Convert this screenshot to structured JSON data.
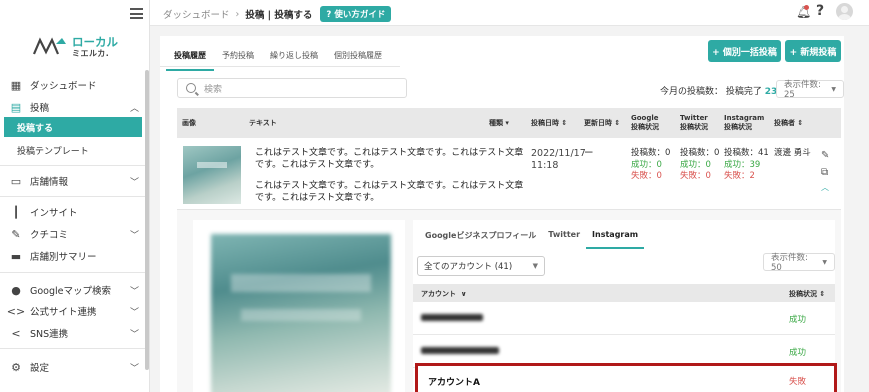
{
  "topbar": {
    "breadcrumb_root": "ダッシュボード",
    "breadcrumb_sep": "›",
    "breadcrumb_current": "投稿 | 投稿する",
    "guide_button": "使い方ガイド"
  },
  "sidebar": {
    "logo_main": "ローカル",
    "logo_sub": "ミエルカ.",
    "items": [
      {
        "label": "ダッシュボード"
      },
      {
        "label": "投稿"
      },
      {
        "label": "投稿する"
      },
      {
        "label": "投稿テンプレート"
      },
      {
        "label": "店舗情報"
      },
      {
        "label": "インサイト"
      },
      {
        "label": "クチコミ"
      },
      {
        "label": "店舗別サマリー"
      },
      {
        "label": "Googleマップ検索"
      },
      {
        "label": "公式サイト連携"
      },
      {
        "label": "SNS連携"
      },
      {
        "label": "設定"
      }
    ]
  },
  "main": {
    "tabs": [
      "投稿履歴",
      "予約投稿",
      "繰り返し投稿",
      "個別投稿履歴"
    ],
    "btn_bulk": "+ 個別一括投稿",
    "btn_new": "+ 新規投稿",
    "search_placeholder": "検索",
    "month_label": "今月の投稿数： 投稿完了",
    "month_value": "23",
    "perpage": "表示件数: 25",
    "columns": {
      "image": "画像",
      "text": "テキスト",
      "type": "種類",
      "posted_at": "投稿日時",
      "updated_at": "更新日時",
      "google_1": "Google",
      "google_2": "投稿状況",
      "twitter_1": "Twitter",
      "twitter_2": "投稿状況",
      "instagram_1": "Instagram",
      "instagram_2": "投稿状況",
      "author": "投稿者"
    },
    "row": {
      "text1": "これはテスト文章です。これはテスト文章です。これはテスト文章です。これはテスト文章です。",
      "text2": "これはテスト文章です。これはテスト文章です。これはテスト文章です。これはテスト文章です。",
      "date": "2022/11/17",
      "time": "11:18",
      "updated": "ー",
      "google": {
        "count": "投稿数：0",
        "ok": "成功：0",
        "ng": "失敗：0"
      },
      "twitter": {
        "count": "投稿数：0",
        "ok": "成功：0",
        "ng": "失敗：0"
      },
      "instagram": {
        "count": "投稿数：41",
        "ok": "成功：39",
        "ng": "失敗：2"
      },
      "author": "渡邊 勇斗"
    }
  },
  "detail": {
    "tabs": [
      "Googleビジネスプロフィール",
      "Twitter",
      "Instagram"
    ],
    "account_select": "全てのアカウント (41)",
    "perpage": "表示件数: 50",
    "col_account": "アカウント",
    "col_status": "投稿状況",
    "rows": [
      {
        "status": "成功"
      },
      {
        "status": "成功"
      },
      {
        "name": "アカウントA",
        "status": "失敗"
      }
    ]
  },
  "colors": {
    "accent": "#2eaaa4",
    "success": "#3aa845",
    "fail": "#d9534f",
    "highlight": "#b01818"
  }
}
